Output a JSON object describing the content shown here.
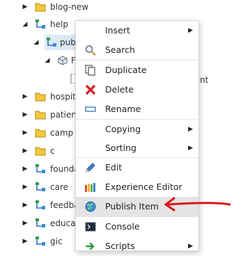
{
  "tree": {
    "items": [
      {
        "label": "blog-new",
        "icon": "folder-icon",
        "expanded": false
      },
      {
        "label": "help",
        "icon": "branch-icon",
        "expanded": true
      },
      {
        "label": "pub",
        "icon": "branch-icon",
        "expanded": true,
        "selected": true
      },
      {
        "label": "F",
        "icon": "cube-icon",
        "expanded": true
      },
      {
        "label": "hospit",
        "icon": "folder-icon",
        "expanded": false
      },
      {
        "label": "patien",
        "icon": "folder-icon",
        "expanded": false
      },
      {
        "label": "camp",
        "icon": "folder-icon",
        "expanded": false
      },
      {
        "label": "c",
        "icon": "folder-icon",
        "expanded": false
      },
      {
        "label": "founda",
        "icon": "branch-icon",
        "expanded": false
      },
      {
        "label": "care",
        "icon": "branch-icon",
        "expanded": false
      },
      {
        "label": "feedba",
        "icon": "branch-icon",
        "expanded": false
      },
      {
        "label": "educat",
        "icon": "branch-icon",
        "expanded": false
      },
      {
        "label": "gic",
        "icon": "branch-icon",
        "expanded": false
      }
    ],
    "partial_text": "ment"
  },
  "context_menu": {
    "items": [
      {
        "label": "Insert",
        "icon": "",
        "submenu": true
      },
      {
        "label": "Search",
        "icon": "search-icon",
        "submenu": false
      },
      {
        "label": "Duplicate",
        "icon": "duplicate-icon",
        "submenu": false
      },
      {
        "label": "Delete",
        "icon": "delete-icon",
        "submenu": false
      },
      {
        "label": "Rename",
        "icon": "rename-icon",
        "submenu": false
      },
      {
        "label": "Copying",
        "icon": "",
        "submenu": true
      },
      {
        "label": "Sorting",
        "icon": "",
        "submenu": true
      },
      {
        "label": "Edit",
        "icon": "edit-icon",
        "submenu": false
      },
      {
        "label": "Experience Editor",
        "icon": "experience-editor-icon",
        "submenu": false
      },
      {
        "label": "Publish Item",
        "icon": "publish-icon",
        "submenu": false,
        "highlighted": true
      },
      {
        "label": "Console",
        "icon": "console-icon",
        "submenu": false
      },
      {
        "label": "Scripts",
        "icon": "scripts-icon",
        "submenu": true
      }
    ]
  },
  "colors": {
    "selection": "#dde9f7",
    "menu_hover": "#e4e4e4",
    "annotation_arrow": "#d9161c",
    "folder": "#f3c93b"
  }
}
